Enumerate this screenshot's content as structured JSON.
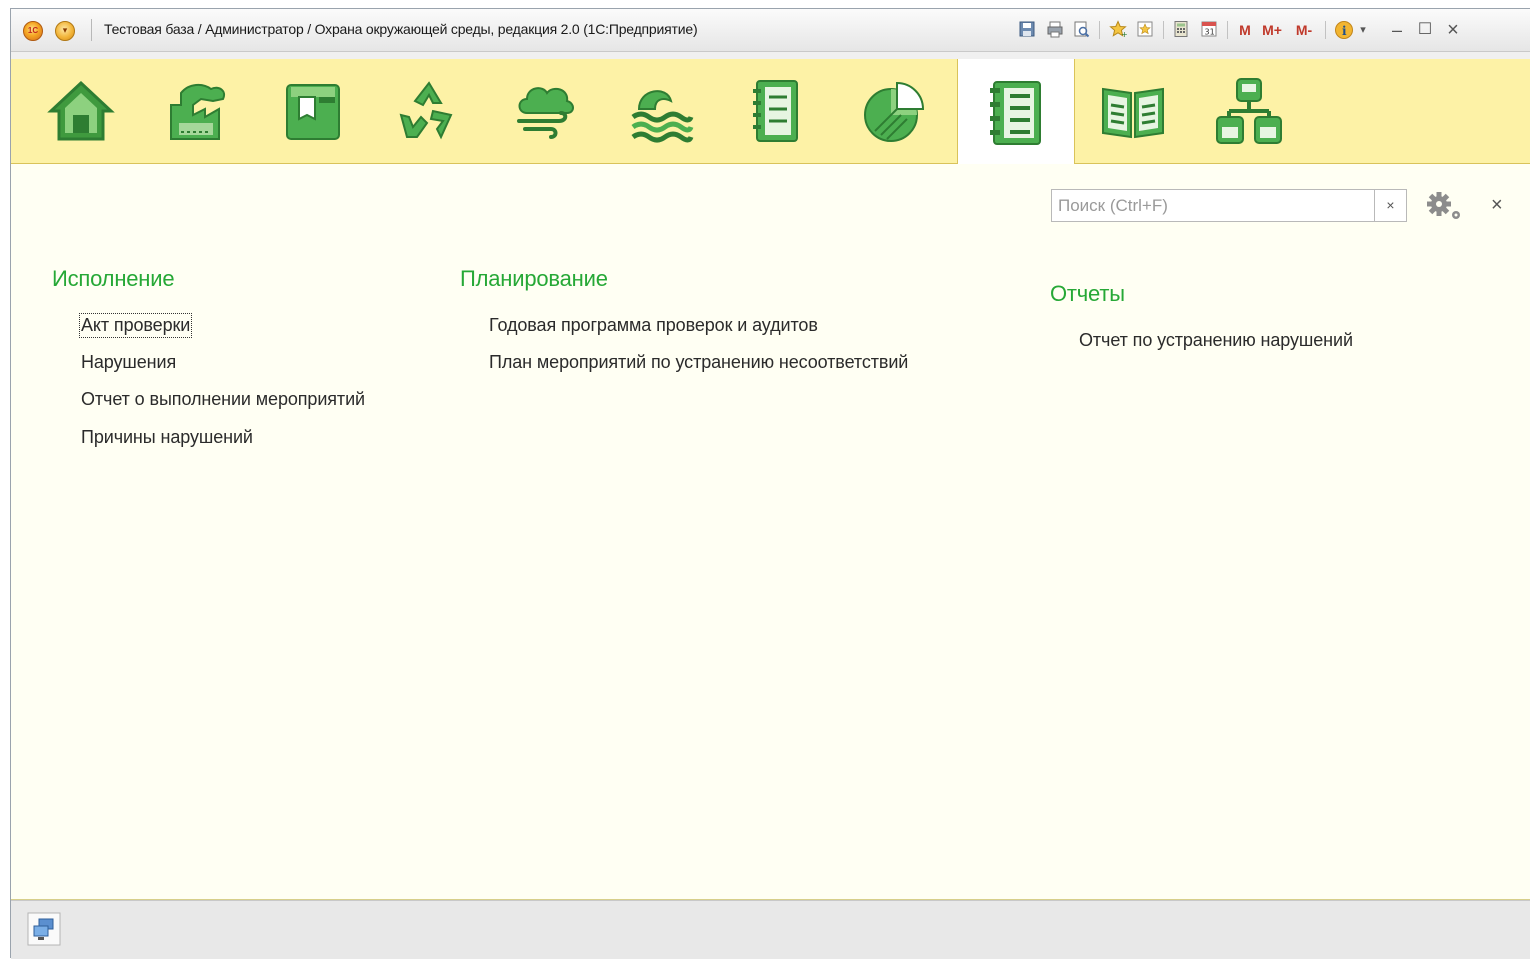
{
  "window": {
    "title": "Тестовая база / Администратор / Охрана окружающей среды, редакция 2.0  (1С:Предприятие)",
    "logo_text": "1С",
    "toolbar": {
      "memory_buttons": [
        "M",
        "M+",
        "M-"
      ],
      "info_icon": "i"
    },
    "controls": {
      "minimize": "–",
      "maximize": "☐",
      "close": "×"
    }
  },
  "sections": [
    {
      "icon": "home-icon"
    },
    {
      "icon": "factory-icon"
    },
    {
      "icon": "waste-bin-icon"
    },
    {
      "icon": "recycle-icon"
    },
    {
      "icon": "air-cloud-icon"
    },
    {
      "icon": "water-waves-icon"
    },
    {
      "icon": "book-ledger-icon"
    },
    {
      "icon": "pie-chart-icon"
    },
    {
      "icon": "checklist-icon",
      "active": true
    },
    {
      "icon": "open-book-icon"
    },
    {
      "icon": "hierarchy-icon"
    }
  ],
  "search": {
    "placeholder": "Поиск (Ctrl+F)",
    "clear": "×"
  },
  "close_label": "×",
  "groups": {
    "execution": {
      "title": "Исполнение",
      "items": [
        "Акт проверки",
        "Нарушения",
        "Отчет о выполнении мероприятий",
        "Причины нарушений"
      ]
    },
    "planning": {
      "title": "Планирование",
      "items": [
        "Годовая программа проверок и аудитов",
        "План мероприятий по устранению несоответствий"
      ]
    },
    "reports": {
      "title": "Отчеты",
      "items": [
        "Отчет по устранению нарушений"
      ]
    }
  },
  "colors": {
    "accent_green": "#26a836",
    "icon_green": "#4caf50",
    "section_bg": "#fdf2a6",
    "content_bg": "#fffff3"
  }
}
